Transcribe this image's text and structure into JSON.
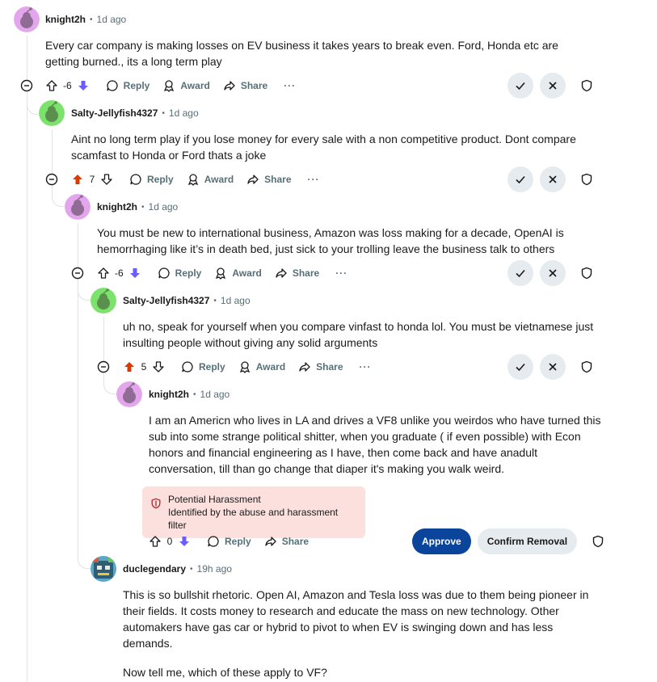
{
  "comments": [
    {
      "user": "knight2h",
      "time": "1d ago",
      "body": "Every car company is making losses on EV business it takes years to break even. Ford, Honda etc are getting burned., its a long term play",
      "votes": "-6",
      "vote_state": "down"
    },
    {
      "user": "Salty-Jellyfish4327",
      "time": "1d ago",
      "body": "Aint no long term play if you lose money for every sale with a non competitive product. Dont compare scamfast to Honda or Ford thats a joke",
      "votes": "7",
      "vote_state": "up"
    },
    {
      "user": "knight2h",
      "time": "1d ago",
      "body": "You must be new to international business, Amazon was loss making for a decade, OpenAI is hemorrhaging like it’s in death bed, just sick to your trolling leave the business talk to others",
      "votes": "-6",
      "vote_state": "down"
    },
    {
      "user": "Salty-Jellyfish4327",
      "time": "1d ago",
      "body": "uh no, speak for yourself when you compare vinfast to honda lol. You must be vietnamese just insulting people without giving any solid arguments",
      "votes": "5",
      "vote_state": "up"
    },
    {
      "user": "knight2h",
      "time": "1d ago",
      "body": "I am an Americn who lives in LA and drives a VF8 unlike you weirdos who have turned this sub into some strange political shitter, when you graduate ( if even possible) with Econ honors and financial engineering as I have, then come back and have anadult conversation, till than go change that diaper it's making you walk weird.",
      "votes": "0",
      "vote_state": "down",
      "warning_title": "Potential Harassment",
      "warning_sub": "Identified by the abuse and harassment filter"
    },
    {
      "user": "duclegendary",
      "time": "19h ago",
      "body": "This is so bullshit rhetoric. Open AI, Amazon and Tesla loss was due to them being pioneer in their fields. It costs money to research and educate the mass on new technology. Other automakers have gas car or hybrid to pivot to when EV is swinging down and has less demands.",
      "body2": "Now tell me, which of these apply to VF?"
    }
  ],
  "labels": {
    "reply": "Reply",
    "award": "Award",
    "share": "Share",
    "more": "···",
    "approve": "Approve",
    "confirm_removal": "Confirm Removal",
    "dot": "•"
  },
  "colors": {
    "upvote": "#d93a00",
    "downvote": "#6a5cff",
    "approve": "#0a449b",
    "warning_bg": "#fce0dd"
  }
}
